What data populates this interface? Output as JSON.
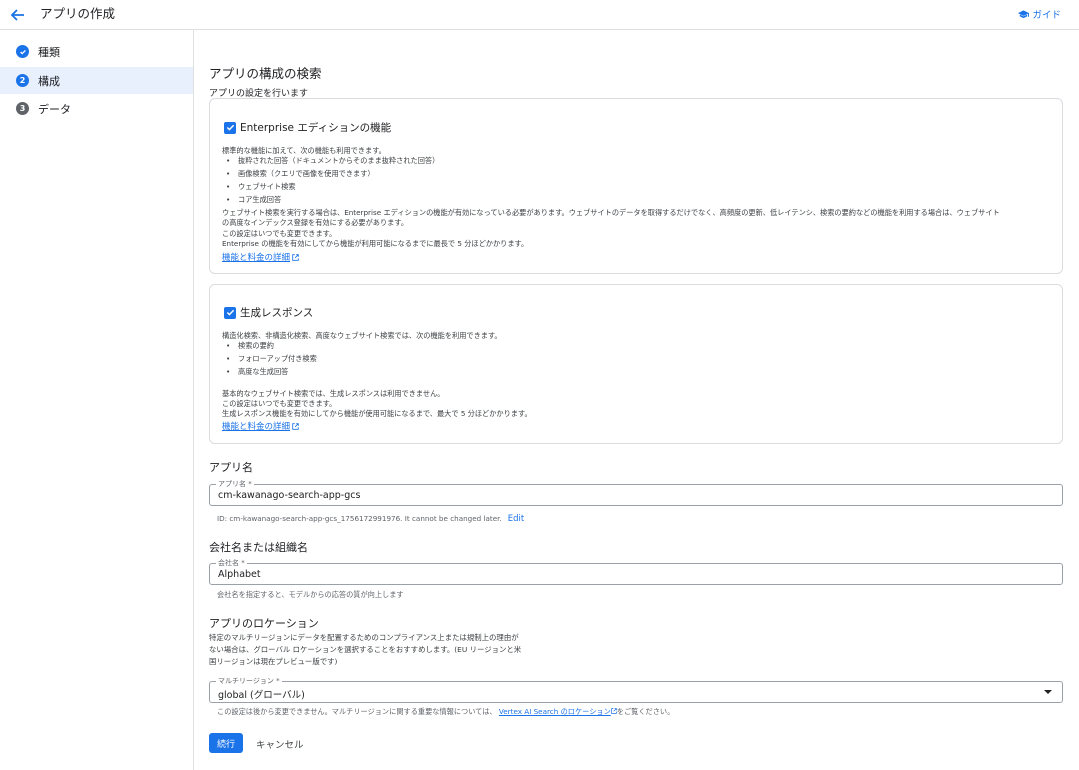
{
  "header": {
    "title": "アプリの作成",
    "guide_label": "ガイド"
  },
  "sidebar": {
    "steps": [
      {
        "label": "種類",
        "marker": ""
      },
      {
        "label": "構成",
        "marker": "2"
      },
      {
        "label": "データ",
        "marker": "3"
      }
    ]
  },
  "main": {
    "title": "アプリの構成の検索",
    "subtitle": "アプリの設定を行います",
    "enterprise": {
      "label": "Enterprise エディションの機能",
      "checked": true,
      "intro": "標準的な機能に加えて、次の機能も利用できます。",
      "bullets": [
        "抜粋された回答（ドキュメントからそのまま抜粋された回答）",
        "画像検索（クエリで画像を使用できます）",
        "ウェブサイト検索",
        "コア生成回答"
      ],
      "note1": "ウェブサイト検索を実行する場合は、Enterprise エディションの機能が有効になっている必要があります。ウェブサイトのデータを取得するだけでなく、高頻度の更新、低レイテンシ、検索の要約などの機能を利用する場合は、ウェブサイト",
      "note2": "の高度なインデックス登録を有効にする必要があります。",
      "note3": "この設定はいつでも変更できます。",
      "note4": "Enterprise の機能を有効にしてから機能が利用可能になるまでに最長で 5 分ほどかかります。",
      "link": "機能と料金の詳細"
    },
    "generative": {
      "label": "生成レスポンス",
      "checked": true,
      "intro": "構造化検索、非構造化検索、高度なウェブサイト検索では、次の機能を利用できます。",
      "bullets": [
        "検索の要約",
        "フォローアップ付き検索",
        "高度な生成回答"
      ],
      "note1": "基本的なウェブサイト検索では、生成レスポンスは利用できません。",
      "note2": "この設定はいつでも変更できます。",
      "note3": "生成レスポンス機能を有効にしてから機能が使用可能になるまで、最大で 5 分ほどかかります。",
      "link": "機能と料金の詳細"
    },
    "app_name": {
      "heading": "アプリ名",
      "label": "アプリ名 *",
      "value": "cm-kawanago-search-app-gcs",
      "id_hint": "ID: cm-kawanago-search-app-gcs_1756172991976. It cannot be changed later.",
      "edit": "Edit"
    },
    "company": {
      "heading": "会社名または組織名",
      "label": "会社名 *",
      "value": "Alphabet",
      "hint": "会社名を指定すると、モデルからの応答の質が向上します"
    },
    "location": {
      "heading": "アプリのロケーション",
      "desc1": "特定のマルチリージョンにデータを配置するためのコンプライアンス上または規制上の理由が",
      "desc2": "ない場合は、グローバル ロケーションを選択することをおすすめします。(EU リージョンと米",
      "desc3": "国リージョンは現在プレビュー版です)",
      "label": "マルチリージョン *",
      "value": "global (グローバル)",
      "hint_pre": "この設定は後から変更できません。マルチリージョンに関する重要な情報については、",
      "hint_link": "Vertex AI Search のロケーション",
      "hint_post": "をご覧ください。"
    },
    "actions": {
      "continue": "続行",
      "cancel": "キャンセル"
    }
  }
}
